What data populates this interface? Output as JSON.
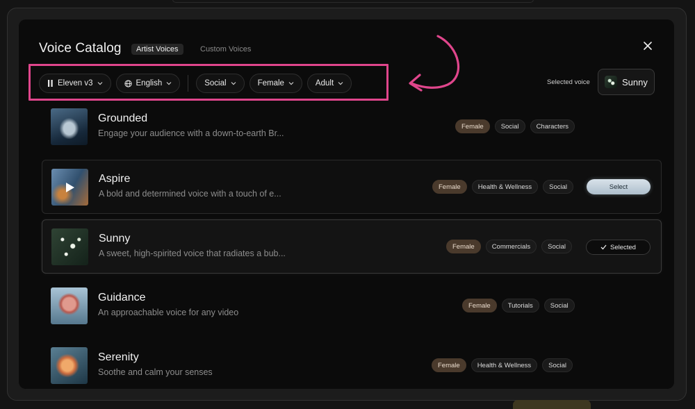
{
  "modal": {
    "title": "Voice Catalog",
    "tabs": [
      {
        "label": "Artist Voices",
        "active": true
      },
      {
        "label": "Custom Voices",
        "active": false
      }
    ],
    "close_icon": "close-icon"
  },
  "filters": {
    "model": "Eleven v3",
    "language": "English",
    "category": "Social",
    "gender": "Female",
    "age": "Adult"
  },
  "selected_voice": {
    "label": "Selected voice",
    "name": "Sunny"
  },
  "voices": [
    {
      "name": "Grounded",
      "description": "Engage your audience with a down-to-earth Br...",
      "tags": [
        "Female",
        "Social",
        "Characters"
      ]
    },
    {
      "name": "Aspire",
      "description": "A bold and determined voice with a touch of e...",
      "tags": [
        "Female",
        "Health & Wellness",
        "Social"
      ],
      "action": "Select"
    },
    {
      "name": "Sunny",
      "description": "A sweet, high-spirited voice that radiates a bub...",
      "tags": [
        "Female",
        "Commercials",
        "Social"
      ],
      "action": "Selected"
    },
    {
      "name": "Guidance",
      "description": "An approachable voice for any video",
      "tags": [
        "Female",
        "Tutorials",
        "Social"
      ]
    },
    {
      "name": "Serenity",
      "description": "Soothe and calm your senses",
      "tags": [
        "Female",
        "Health & Wellness",
        "Social"
      ]
    }
  ],
  "colors": {
    "highlight": "#e0468c",
    "female_tag": "#4a3a2c",
    "modal_bg": "#0b0b0b"
  }
}
